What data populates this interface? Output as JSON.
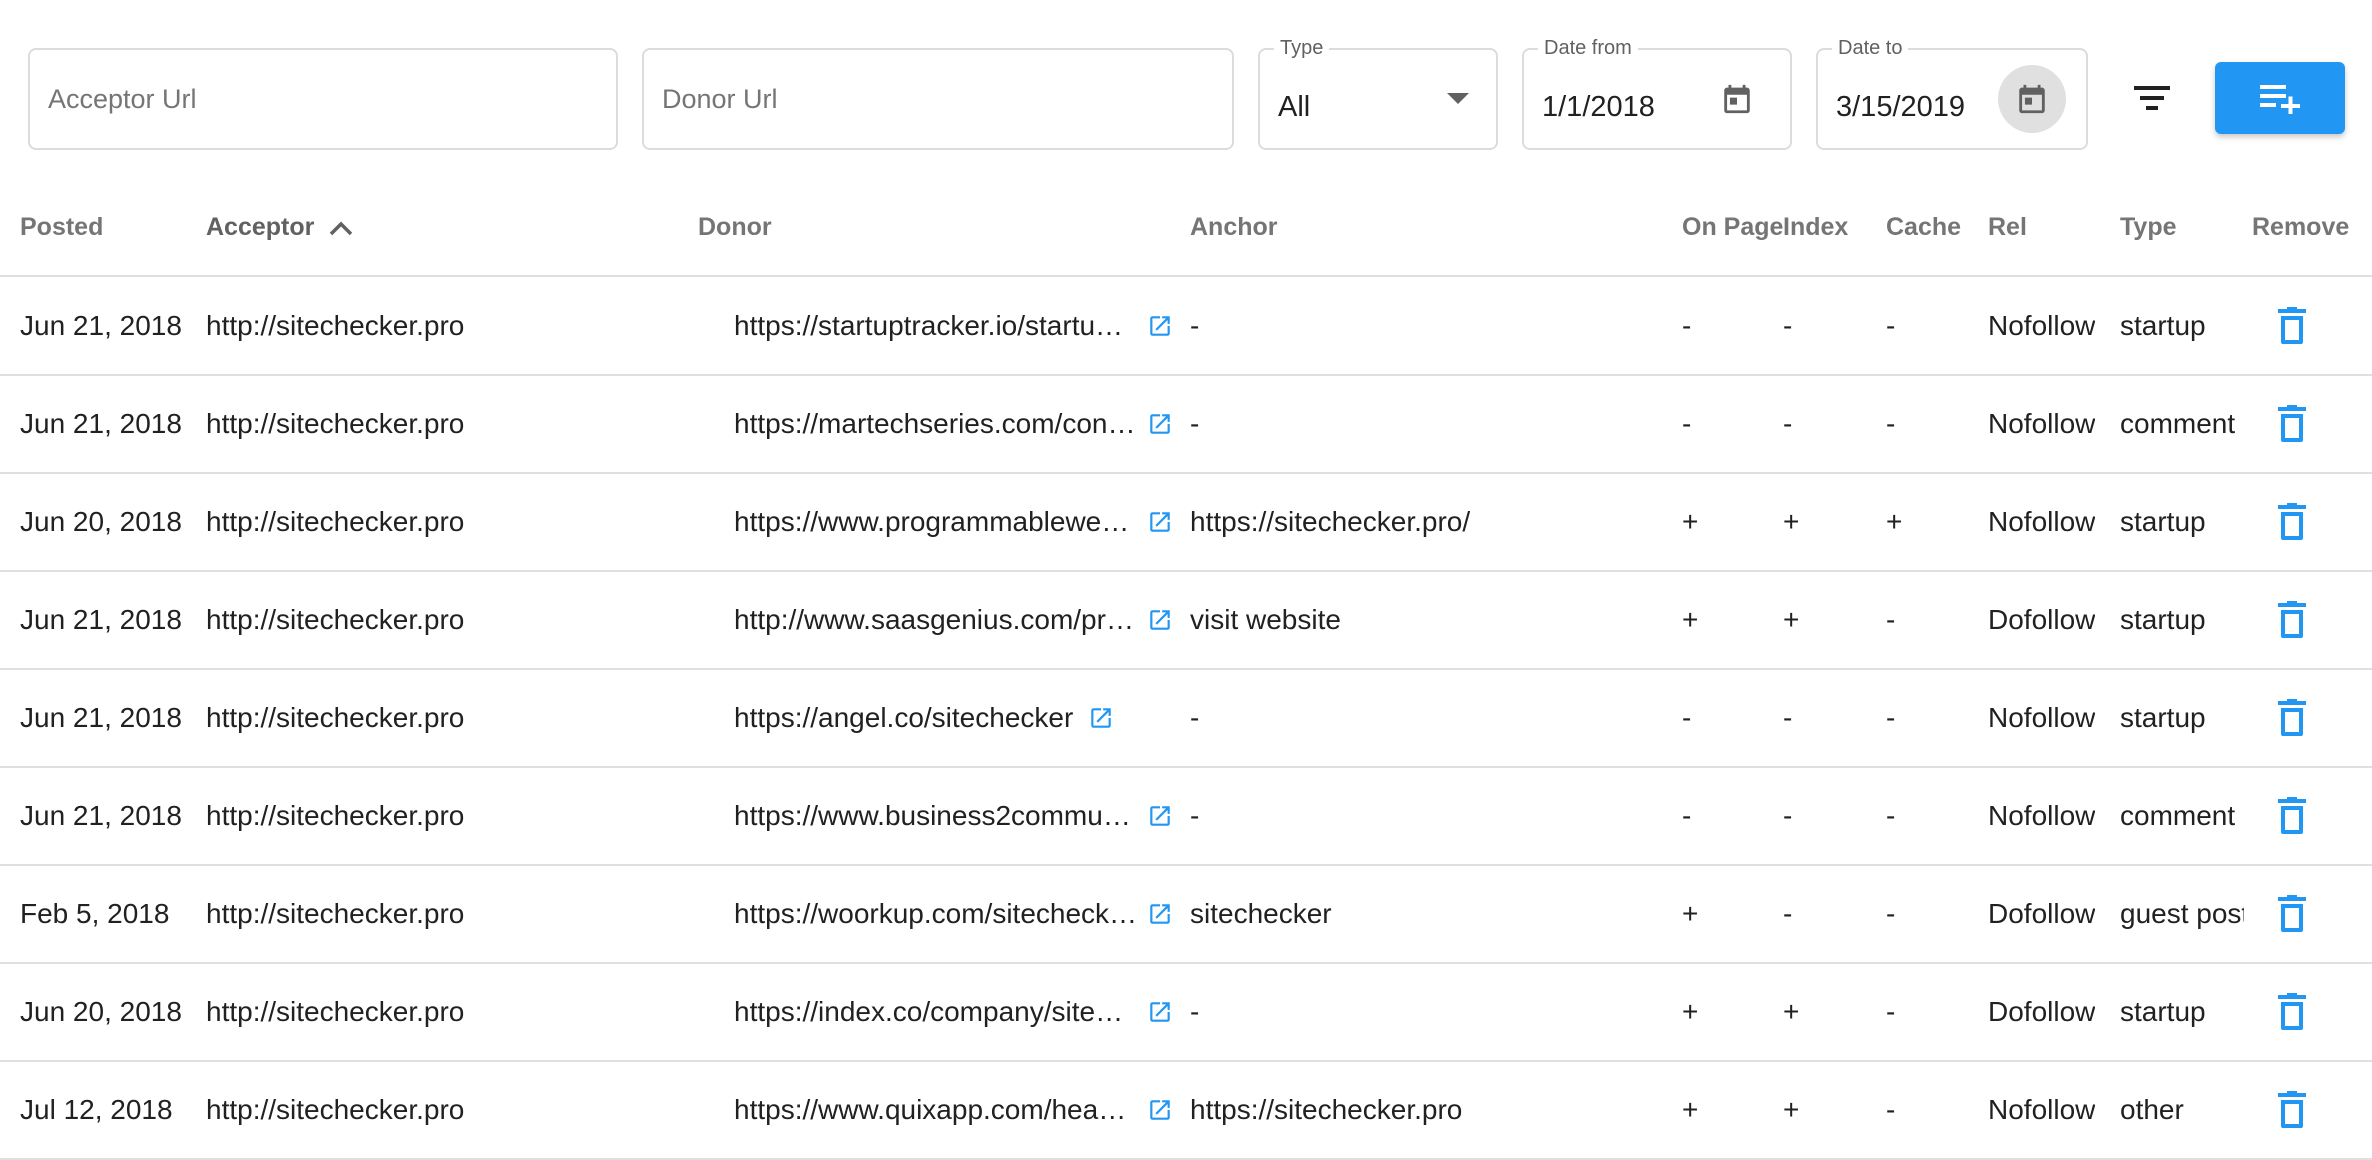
{
  "filters": {
    "acceptor_placeholder": "Acceptor Url",
    "donor_placeholder": "Donor Url",
    "type_label": "Type",
    "type_value": "All",
    "date_from_label": "Date from",
    "date_from_value": "1/1/2018",
    "date_to_label": "Date to",
    "date_to_value": "3/15/2019"
  },
  "table": {
    "headers": {
      "posted": "Posted",
      "acceptor": "Acceptor",
      "donor": "Donor",
      "anchor": "Anchor",
      "on_page": "On Page",
      "index": "Index",
      "cache": "Cache",
      "rel": "Rel",
      "type": "Type",
      "remove": "Remove"
    },
    "rows": [
      {
        "posted": "Jun 21, 2018",
        "acceptor": "http://sitechecker.pro",
        "donor": "https://startuptracker.io/startu…",
        "anchor": "-",
        "on_page": "-",
        "index": "-",
        "cache": "-",
        "rel": "Nofollow",
        "type": "startup"
      },
      {
        "posted": "Jun 21, 2018",
        "acceptor": "http://sitechecker.pro",
        "donor": "https://martechseries.com/con…",
        "anchor": "-",
        "on_page": "-",
        "index": "-",
        "cache": "-",
        "rel": "Nofollow",
        "type": "comment"
      },
      {
        "posted": "Jun 20, 2018",
        "acceptor": "http://sitechecker.pro",
        "donor": "https://www.programmablewe…",
        "anchor": "https://sitechecker.pro/",
        "on_page": "+",
        "index": "+",
        "cache": "+",
        "rel": "Nofollow",
        "type": "startup"
      },
      {
        "posted": "Jun 21, 2018",
        "acceptor": "http://sitechecker.pro",
        "donor": "http://www.saasgenius.com/pr…",
        "anchor": "visit website",
        "on_page": "+",
        "index": "+",
        "cache": "-",
        "rel": "Dofollow",
        "type": "startup"
      },
      {
        "posted": "Jun 21, 2018",
        "acceptor": "http://sitechecker.pro",
        "donor": "https://angel.co/sitechecker",
        "anchor": "-",
        "on_page": "-",
        "index": "-",
        "cache": "-",
        "rel": "Nofollow",
        "type": "startup"
      },
      {
        "posted": "Jun 21, 2018",
        "acceptor": "http://sitechecker.pro",
        "donor": "https://www.business2commu…",
        "anchor": "-",
        "on_page": "-",
        "index": "-",
        "cache": "-",
        "rel": "Nofollow",
        "type": "comment"
      },
      {
        "posted": "Feb 5, 2018",
        "acceptor": "http://sitechecker.pro",
        "donor": "https://woorkup.com/sitecheck…",
        "anchor": "sitechecker",
        "on_page": "+",
        "index": "-",
        "cache": "-",
        "rel": "Dofollow",
        "type": "guest post"
      },
      {
        "posted": "Jun 20, 2018",
        "acceptor": "http://sitechecker.pro",
        "donor": "https://index.co/company/site…",
        "anchor": "-",
        "on_page": "+",
        "index": "+",
        "cache": "-",
        "rel": "Dofollow",
        "type": "startup"
      },
      {
        "posted": "Jul 12, 2018",
        "acceptor": "http://sitechecker.pro",
        "donor": "https://www.quixapp.com/hea…",
        "anchor": "https://sitechecker.pro",
        "on_page": "+",
        "index": "+",
        "cache": "-",
        "rel": "Nofollow",
        "type": "other"
      }
    ]
  },
  "icons": {
    "dropdown": "arrow-drop-down-icon",
    "calendar": "calendar-icon",
    "filter": "filter-list-icon",
    "add": "playlist-add-icon",
    "sort": "chevron-up-icon",
    "external": "open-in-new-icon",
    "delete": "delete-icon"
  },
  "colors": {
    "accent": "#2196f3",
    "divider": "#e0e0e0",
    "header_text": "#757575"
  }
}
